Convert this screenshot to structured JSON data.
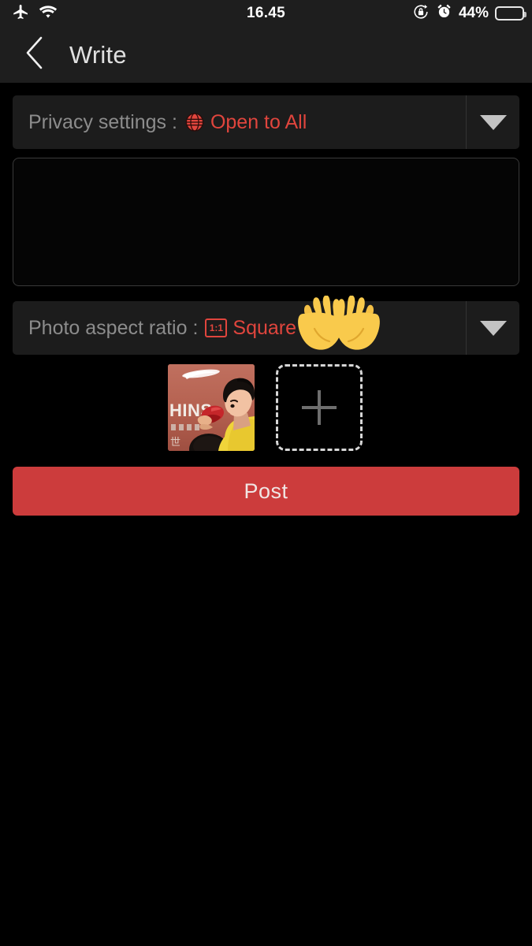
{
  "status_bar": {
    "airplane_icon": "airplane-mode-icon",
    "wifi_icon": "wifi-icon",
    "time": "16.45",
    "rotation_lock_icon": "rotation-lock-icon",
    "alarm_icon": "alarm-clock-icon",
    "battery_percent": "44%",
    "battery_level": 44,
    "battery_color": "#f5cd19",
    "bar_background": "#1e1e1e"
  },
  "nav": {
    "back_icon": "back-chevron-icon",
    "title": "Write"
  },
  "privacy_row": {
    "label": "Privacy settings :",
    "value": "Open to All",
    "icon": "globe-icon",
    "value_color": "#e0453d",
    "caret_icon": "chevron-down-icon"
  },
  "editor": {
    "value": "",
    "placeholder": ""
  },
  "aspect_row": {
    "label": "Photo aspect ratio :",
    "value": "Square",
    "icon": "one-to-one-ratio-icon",
    "icon_text": "1:1",
    "value_color": "#e0453d",
    "caret_icon": "chevron-down-icon"
  },
  "emoji": {
    "name": "open-hands-emoji",
    "glyph": "👐"
  },
  "thumbnails": {
    "photo_alt": "attached-photo-thumbnail",
    "photo_text": "HINS",
    "add_icon": "plus-icon"
  },
  "post_button": {
    "label": "Post",
    "color": "#cc3c3c"
  }
}
